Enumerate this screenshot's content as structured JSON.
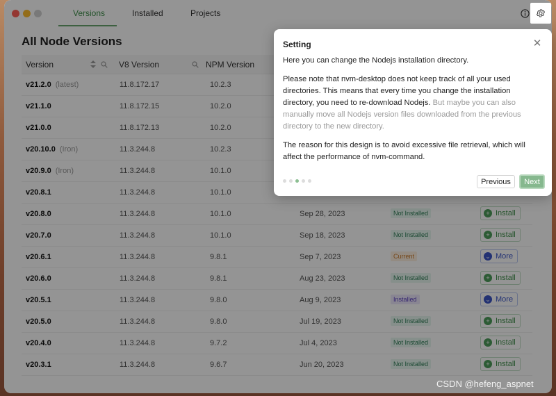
{
  "window": {
    "tabs": [
      {
        "label": "Versions",
        "active": true
      },
      {
        "label": "Installed",
        "active": false
      },
      {
        "label": "Projects",
        "active": false
      }
    ],
    "icons": {
      "info": "info-icon",
      "settings": "gear-icon"
    }
  },
  "page": {
    "title": "All Node Versions"
  },
  "table": {
    "headers": {
      "version": "Version",
      "v8": "V8 Version",
      "npm": "NPM Version"
    },
    "rows": [
      {
        "version": "v21.2.0",
        "tag": "(latest)",
        "v8": "11.8.172.17",
        "npm": "10.2.3",
        "date": "",
        "status": "",
        "action": ""
      },
      {
        "version": "v21.1.0",
        "tag": "",
        "v8": "11.8.172.15",
        "npm": "10.2.0",
        "date": "",
        "status": "",
        "action": ""
      },
      {
        "version": "v21.0.0",
        "tag": "",
        "v8": "11.8.172.13",
        "npm": "10.2.0",
        "date": "",
        "status": "",
        "action": ""
      },
      {
        "version": "v20.10.0",
        "tag": "(Iron)",
        "v8": "11.3.244.8",
        "npm": "10.2.3",
        "date": "",
        "status": "",
        "action": ""
      },
      {
        "version": "v20.9.0",
        "tag": "(Iron)",
        "v8": "11.3.244.8",
        "npm": "10.1.0",
        "date": "",
        "status": "",
        "action": ""
      },
      {
        "version": "v20.8.1",
        "tag": "",
        "v8": "11.3.244.8",
        "npm": "10.1.0",
        "date": "",
        "status": "",
        "action": ""
      },
      {
        "version": "v20.8.0",
        "tag": "",
        "v8": "11.3.244.8",
        "npm": "10.1.0",
        "date": "Sep 28, 2023",
        "status": "Not Installed",
        "action": "Install"
      },
      {
        "version": "v20.7.0",
        "tag": "",
        "v8": "11.3.244.8",
        "npm": "10.1.0",
        "date": "Sep 18, 2023",
        "status": "Not Installed",
        "action": "Install"
      },
      {
        "version": "v20.6.1",
        "tag": "",
        "v8": "11.3.244.8",
        "npm": "9.8.1",
        "date": "Sep 7, 2023",
        "status": "Current",
        "action": "More"
      },
      {
        "version": "v20.6.0",
        "tag": "",
        "v8": "11.3.244.8",
        "npm": "9.8.1",
        "date": "Aug 23, 2023",
        "status": "Not Installed",
        "action": "Install"
      },
      {
        "version": "v20.5.1",
        "tag": "",
        "v8": "11.3.244.8",
        "npm": "9.8.0",
        "date": "Aug 9, 2023",
        "status": "Installed",
        "action": "More"
      },
      {
        "version": "v20.5.0",
        "tag": "",
        "v8": "11.3.244.8",
        "npm": "9.8.0",
        "date": "Jul 19, 2023",
        "status": "Not Installed",
        "action": "Install"
      },
      {
        "version": "v20.4.0",
        "tag": "",
        "v8": "11.3.244.8",
        "npm": "9.7.2",
        "date": "Jul 4, 2023",
        "status": "Not Installed",
        "action": "Install"
      },
      {
        "version": "v20.3.1",
        "tag": "",
        "v8": "11.3.244.8",
        "npm": "9.6.7",
        "date": "Jun 20, 2023",
        "status": "Not Installed",
        "action": "Install"
      }
    ]
  },
  "tour": {
    "title": "Setting",
    "p1": "Here you can change the Nodejs installation directory.",
    "p2_main": "Please note that nvm-desktop does not keep track of all your used directories. This means that every time you change the installation directory, you need to re-download Nodejs.",
    "p2_muted": "But maybe you can also manually move all Nodejs version files downloaded from the previous directory to the new directory.",
    "p3": "The reason for this design is to avoid excessive file retrieval, which will affect the performance of nvm-command.",
    "step_current": 3,
    "step_total": 5,
    "prev_label": "Previous",
    "next_label": "Next"
  },
  "watermark": "CSDN @hefeng_aspnet",
  "colors": {
    "accent": "#3f8f4a",
    "next_button": "#86b88e",
    "more_button": "#3b55c7"
  }
}
